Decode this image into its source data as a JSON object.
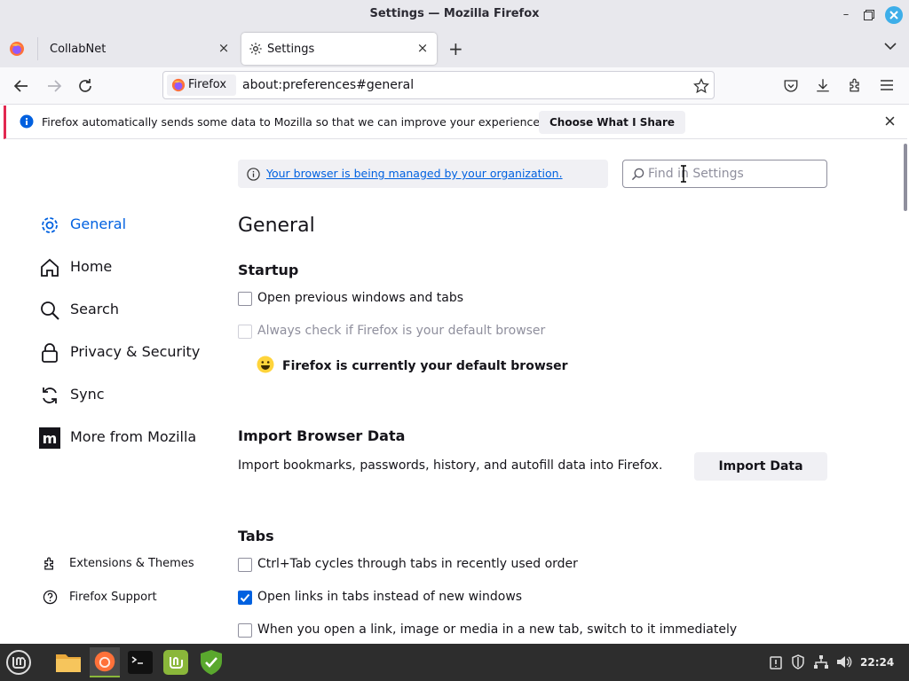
{
  "window": {
    "title": "Settings — Mozilla Firefox"
  },
  "tabs": [
    {
      "label": "CollabNet"
    },
    {
      "label": "Settings"
    }
  ],
  "urlbar": {
    "identity": "Firefox",
    "url": "about:preferences#general"
  },
  "notification": {
    "message": "Firefox automatically sends some data to Mozilla so that we can improve your experience.",
    "button": "Choose What I Share"
  },
  "managed_notice": "Your browser is being managed by your organization.",
  "search": {
    "placeholder": "Find in Settings"
  },
  "sidebar": {
    "categories": [
      {
        "label": "General"
      },
      {
        "label": "Home"
      },
      {
        "label": "Search"
      },
      {
        "label": "Privacy & Security"
      },
      {
        "label": "Sync"
      },
      {
        "label": "More from Mozilla"
      }
    ],
    "footer": [
      {
        "label": "Extensions & Themes"
      },
      {
        "label": "Firefox Support"
      }
    ]
  },
  "main": {
    "title": "General",
    "startup": {
      "heading": "Startup",
      "open_previous": "Open previous windows and tabs",
      "always_check": "Always check if Firefox is your default browser",
      "default_status": "Firefox is currently your default browser"
    },
    "import": {
      "heading": "Import Browser Data",
      "description": "Import bookmarks, passwords, history, and autofill data into Firefox.",
      "button": "Import Data"
    },
    "tabs_section": {
      "heading": "Tabs",
      "ctrl_tab": "Ctrl+Tab cycles through tabs in recently used order",
      "open_links": "Open links in tabs instead of new windows",
      "switch_new_tab": "When you open a link, image or media in a new tab, switch to it immediately"
    }
  },
  "taskbar": {
    "clock": "22:24"
  },
  "colors": {
    "accent": "#0061e0",
    "notif_border": "#e22850"
  }
}
